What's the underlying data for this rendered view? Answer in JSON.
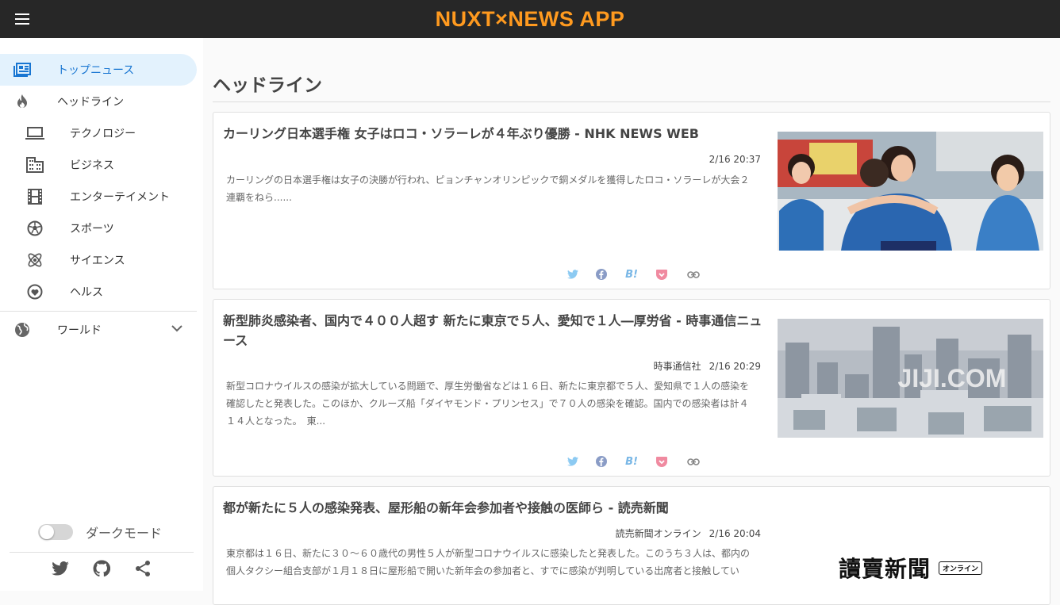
{
  "header": {
    "title": "NUXT×NEWS APP"
  },
  "sidebar": {
    "items": [
      {
        "label": "トップニュース"
      },
      {
        "label": "ヘッドライン"
      },
      {
        "label": "テクノロジー"
      },
      {
        "label": "ビジネス"
      },
      {
        "label": "エンターテイメント"
      },
      {
        "label": "スポーツ"
      },
      {
        "label": "サイエンス"
      },
      {
        "label": "ヘルス"
      },
      {
        "label": "ワールド"
      }
    ],
    "dark_mode_label": "ダークモード",
    "dark_mode_on": false
  },
  "main": {
    "page_title": "ヘッドライン",
    "articles": [
      {
        "title": "カーリング日本選手権 女子はロコ・ソラーレが４年ぶり優勝 - NHK NEWS WEB",
        "source": "",
        "time": "2/16 20:37",
        "description": "カーリングの日本選手権は女子の決勝が行われ、ピョンチャンオリンピックで銅メダルを獲得したロコ・ソラーレが大会２連覇をねら......"
      },
      {
        "title": "新型肺炎感染者、国内で４００人超す 新たに東京で５人、愛知で１人―厚労省 - 時事通信ニュース",
        "source": "時事通信社",
        "time": "2/16 20:29",
        "description": "新型コロナウイルスの感染が拡大している問題で、厚生労働省などは１６日、新たに東京都で５人、愛知県で１人の感染を確認したと発表した。このほか、クルーズ船「ダイヤモンド・プリンセス」で７０人の感染を確認。国内での感染者は計４１４人となった。　東...",
        "image_text": "JIJI.COM"
      },
      {
        "title": "都が新たに５人の感染発表、屋形船の新年会参加者や接触の医師ら - 読売新聞",
        "source": "読売新聞オンライン",
        "time": "2/16 20:04",
        "description": "東京都は１６日、新たに３０～６０歳代の男性５人が新型コロナウイルスに感染したと発表した。このうち３人は、都内の個人タクシー組合支部が１月１８日に屋形船で開いた新年会の参加者と、すでに感染が判明している出席者と接触してい",
        "image_text": "讀賣新聞",
        "image_badge": "オンライン"
      }
    ],
    "share_icons": [
      "twitter-icon",
      "facebook-icon",
      "hatena-bookmark-icon",
      "pocket-icon",
      "link-icon"
    ],
    "share_hatena_text": "B!"
  },
  "footer_icons": [
    "twitter-icon",
    "github-icon",
    "share-icon"
  ],
  "colors": {
    "header_bg": "#272727",
    "title": "#ff9a1f",
    "active": "#1976d2",
    "active_bg": "#e3f2fd"
  }
}
